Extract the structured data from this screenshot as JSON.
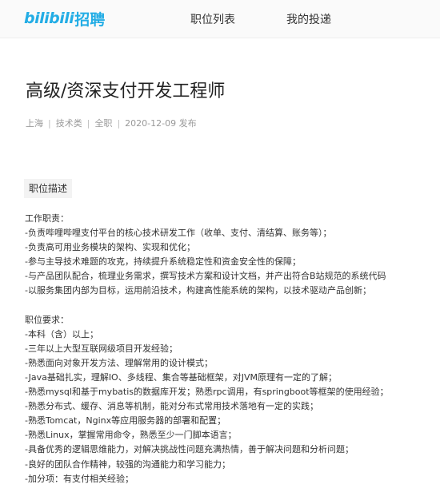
{
  "header": {
    "logo_mark": "bilibili",
    "logo_text": "招聘",
    "nav": [
      "职位列表",
      "我的投递"
    ]
  },
  "job": {
    "title": "高级/资深支付开发工程师",
    "meta": [
      "上海",
      "技术类",
      "全职",
      "2020-12-09 发布"
    ]
  },
  "section_tab": "职位描述",
  "responsibilities": {
    "heading": "工作职责：",
    "items": [
      "-负责哔哩哔哩支付平台的核心技术研发工作（收单、支付、清结算、账务等）；",
      "-负责高可用业务模块的架构、实现和优化；",
      "-参与主导技术难题的攻克，持续提升系统稳定性和资金安全性的保障；",
      "-与产品团队配合，梳理业务需求，撰写技术方案和设计文档，并产出符合B站规范的系统代码",
      "-以服务集团内部为目标，运用前沿技术，构建高性能系统的架构，以技术驱动产品创新；"
    ]
  },
  "requirements": {
    "heading": "职位要求：",
    "items": [
      "-本科（含）以上；",
      "-三年以上大型互联网级项目开发经验；",
      "-熟悉面向对象开发方法、理解常用的设计模式；",
      "-Java基础扎实，理解IO、多线程、集合等基础框架，对JVM原理有一定的了解；",
      "-熟悉mysql和基于mybatis的数据库开发；熟悉rpc调用，有springboot等框架的使用经验；",
      "-熟悉分布式、缓存、消息等机制，能对分布式常用技术落地有一定的实践；",
      "-熟悉Tomcat，Nginx等应用服务器的部署和配置；",
      "-熟悉Linux，掌握常用命令，熟悉至少一门脚本语言；",
      "-具备优秀的逻辑思维能力，对解决挑战性问题充满热情，善于解决问题和分析问题；",
      "-良好的团队合作精神，较强的沟通能力和学习能力；",
      "-加分项：有支付相关经验；"
    ]
  }
}
